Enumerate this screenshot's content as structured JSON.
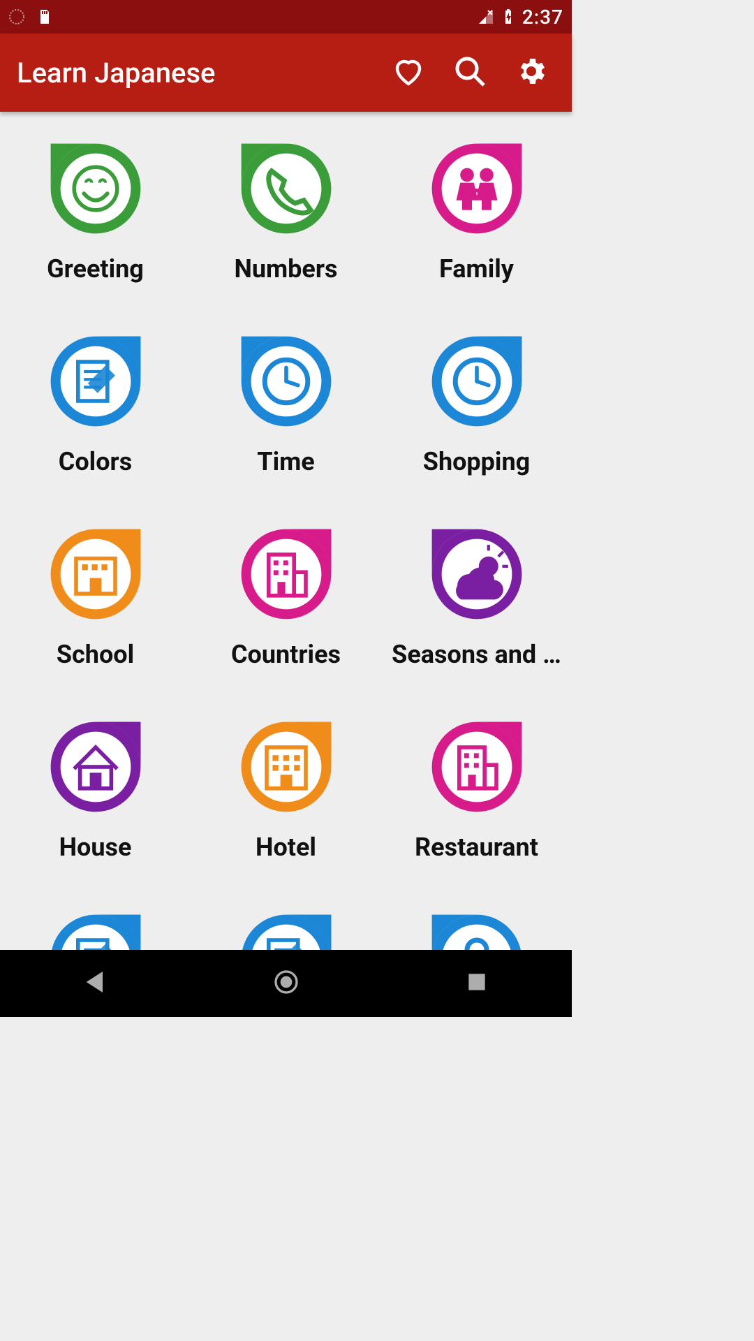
{
  "status": {
    "time": "2:37"
  },
  "appbar": {
    "title": "Learn Japanese"
  },
  "colors": {
    "green": "#3a9d3a",
    "pink": "#d81b8b",
    "blue": "#1b87d6",
    "orange": "#f08c1a",
    "purple": "#7b1fa2"
  },
  "categories": [
    {
      "id": "greeting",
      "label": "Greeting",
      "color": "green",
      "tail": "left",
      "icon": "smile"
    },
    {
      "id": "numbers",
      "label": "Numbers",
      "color": "green",
      "tail": "left",
      "icon": "phone"
    },
    {
      "id": "family",
      "label": "Family",
      "color": "pink",
      "tail": "right",
      "icon": "family"
    },
    {
      "id": "colors",
      "label": "Colors",
      "color": "blue",
      "tail": "right",
      "icon": "notepad"
    },
    {
      "id": "time",
      "label": "Time",
      "color": "blue",
      "tail": "left",
      "icon": "clock"
    },
    {
      "id": "shopping",
      "label": "Shopping",
      "color": "blue",
      "tail": "right",
      "icon": "clock"
    },
    {
      "id": "school",
      "label": "School",
      "color": "orange",
      "tail": "right",
      "icon": "school"
    },
    {
      "id": "countries",
      "label": "Countries",
      "color": "pink",
      "tail": "right",
      "icon": "building"
    },
    {
      "id": "seasons",
      "label": "Seasons and …",
      "color": "purple",
      "tail": "left",
      "icon": "weather"
    },
    {
      "id": "house",
      "label": "House",
      "color": "purple",
      "tail": "right",
      "icon": "house"
    },
    {
      "id": "hotel",
      "label": "Hotel",
      "color": "orange",
      "tail": "right",
      "icon": "hotel"
    },
    {
      "id": "restaurant",
      "label": "Restaurant",
      "color": "pink",
      "tail": "right",
      "icon": "building"
    },
    {
      "id": "partial1",
      "label": "",
      "color": "blue",
      "tail": "right",
      "icon": "notepad"
    },
    {
      "id": "partial2",
      "label": "",
      "color": "blue",
      "tail": "right",
      "icon": "notepad"
    },
    {
      "id": "partial3",
      "label": "",
      "color": "blue",
      "tail": "left",
      "icon": "lock"
    }
  ]
}
